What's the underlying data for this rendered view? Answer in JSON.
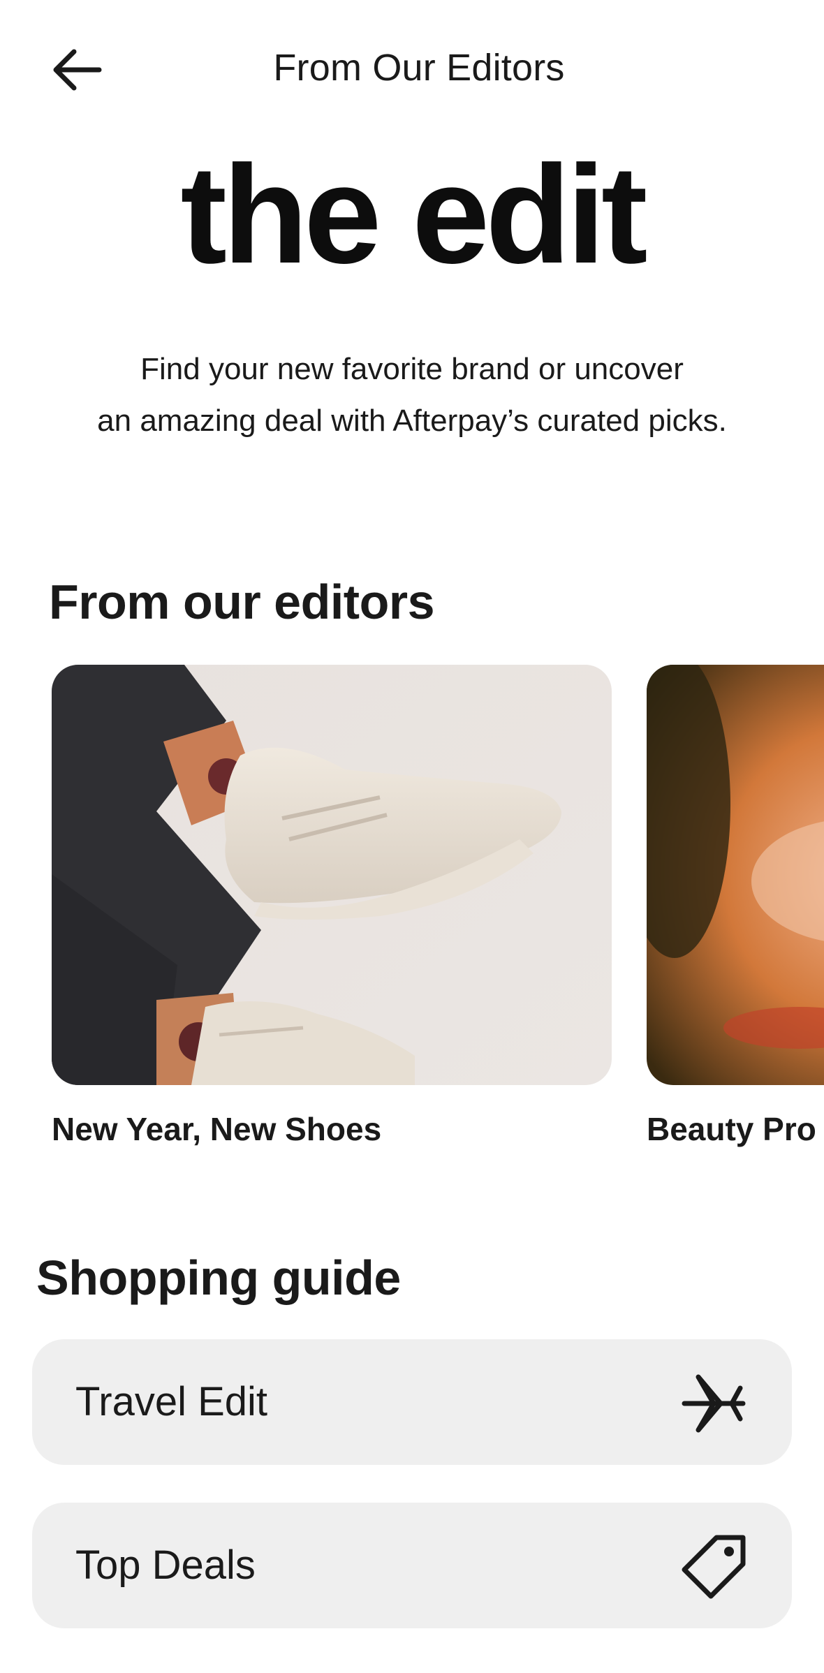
{
  "header": {
    "title": "From Our Editors",
    "back_icon": "arrow-left-icon"
  },
  "hero": {
    "logo_text": "the edit",
    "description_line1": "Find your new favorite brand or uncover",
    "description_line2": "an amazing deal with Afterpay’s curated picks."
  },
  "editors_section": {
    "heading": "From our editors",
    "cards": [
      {
        "title": "New Year, New Shoes",
        "image": "sneaker-photo"
      },
      {
        "title": "Beauty Pro",
        "image": "portrait-photo"
      }
    ]
  },
  "guide_section": {
    "heading": "Shopping guide",
    "items": [
      {
        "label": "Travel Edit",
        "icon": "airplane-icon"
      },
      {
        "label": "Top Deals",
        "icon": "price-tag-icon"
      }
    ]
  },
  "colors": {
    "text": "#1a1a1a",
    "row_background": "#efefef",
    "background": "#ffffff"
  }
}
